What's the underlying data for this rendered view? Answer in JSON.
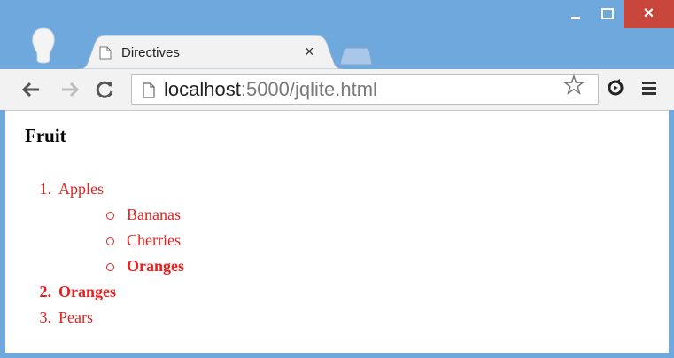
{
  "browser": {
    "tab": {
      "title": "Directives",
      "close_symbol": "×"
    },
    "window_controls": {
      "close_symbol": "×"
    },
    "address": {
      "host": "localhost",
      "path": ":5000/jqlite.html"
    }
  },
  "page": {
    "heading": "Fruit",
    "list": [
      {
        "number": "1.",
        "label": "Apples",
        "bold": false,
        "children": [
          {
            "label": "Bananas",
            "bold": false
          },
          {
            "label": "Cherries",
            "bold": false
          },
          {
            "label": "Oranges",
            "bold": true
          }
        ]
      },
      {
        "number": "2.",
        "label": "Oranges",
        "bold": true
      },
      {
        "number": "3.",
        "label": "Pears",
        "bold": false
      }
    ]
  },
  "colors": {
    "titlebar": "#6fa8dc",
    "close_button": "#c9463c",
    "list_text": "#e8201f"
  },
  "icons": [
    "profile-icon",
    "page-icon",
    "tab-close-icon",
    "new-tab-icon",
    "minimize-icon",
    "maximize-icon",
    "window-close-icon",
    "back-arrow-icon",
    "forward-arrow-icon",
    "reload-icon",
    "star-icon",
    "extension-icon",
    "menu-icon"
  ]
}
